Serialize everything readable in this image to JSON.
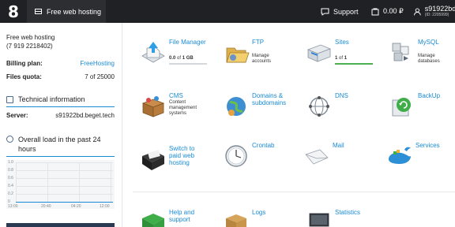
{
  "topbar": {
    "logo": "8",
    "active_tab": "Free web hosting",
    "support_label": "Support",
    "balance": "0.00 ₽",
    "user_name": "s91922bd",
    "user_id": "(ID: 2205999)"
  },
  "account": {
    "name": "Free web hosting",
    "phone": "(7 919 2218402)",
    "billing_label": "Billing plan:",
    "billing_value": "FreeHosting",
    "quota_label": "Files quota:",
    "quota_value": "7 of 25000"
  },
  "tech_info": {
    "title": "Technical information",
    "server_label": "Server:",
    "server_value": "s91922bd.beget.tech"
  },
  "load": {
    "title": "Overall load in the past 24 hours",
    "y_ticks": [
      "1.0",
      "0.8",
      "0.6",
      "0.4",
      "0.2",
      "0"
    ],
    "x_ticks": [
      "13:00",
      "20:40",
      "04:20",
      "12:00"
    ]
  },
  "services": {
    "file_manager": {
      "title": "File Manager",
      "usage_prefix": "0.0",
      "usage_of": " of ",
      "usage_total": "1 GB",
      "progress": 0.0
    },
    "ftp": {
      "title": "FTP",
      "sub1": "Manage",
      "sub2": "accounts"
    },
    "sites": {
      "title": "Sites",
      "usage_prefix": "1",
      "usage_of": " of ",
      "usage_total": "1",
      "progress": 1.0
    },
    "mysql": {
      "title": "MySQL",
      "sub1": "Manage",
      "sub2": "databases"
    },
    "cms": {
      "title": "CMS",
      "sub1": "Content",
      "sub2": "management",
      "sub3": "systems"
    },
    "domains": {
      "title1": "Domains &",
      "title2": "subdomains"
    },
    "dns": {
      "title": "DNS"
    },
    "backup": {
      "title": "BackUp"
    },
    "switch": {
      "title1": "Switch to",
      "title2": "paid web",
      "title3": "hosting"
    },
    "crontab": {
      "title": "Crontab"
    },
    "mail": {
      "title": "Mail"
    },
    "svcs": {
      "title": "Services"
    },
    "help": {
      "title1": "Help and",
      "title2": "support"
    },
    "logs": {
      "title": "Logs"
    },
    "stats": {
      "title": "Statistics"
    }
  },
  "colors": {
    "accent": "#1a8bd4",
    "topbar": "#1f2124",
    "success": "#4caf50"
  }
}
